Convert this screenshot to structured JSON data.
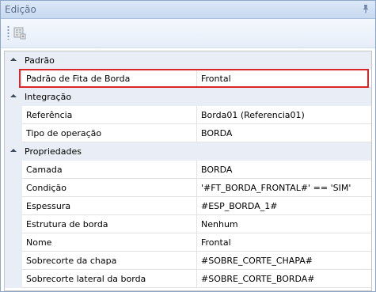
{
  "window": {
    "title": "Edição"
  },
  "categories": [
    {
      "label": "Padrão",
      "properties": [
        {
          "name": "Padrão de Fita de Borda",
          "value": "Frontal"
        }
      ]
    },
    {
      "label": "Integração",
      "properties": [
        {
          "name": "Referência",
          "value": "Borda01 (Referencia01)"
        },
        {
          "name": "Tipo de operação",
          "value": "BORDA"
        }
      ]
    },
    {
      "label": "Propriedades",
      "properties": [
        {
          "name": "Camada",
          "value": "BORDA"
        },
        {
          "name": "Condição",
          "value": "'#FT_BORDA_FRONTAL#' == 'SIM'"
        },
        {
          "name": "Espessura",
          "value": "#ESP_BORDA_1#"
        },
        {
          "name": "Estrutura de borda",
          "value": "Nenhum"
        },
        {
          "name": "Nome",
          "value": "Frontal"
        },
        {
          "name": "Sobrecorte da chapa",
          "value": "#SOBRE_CORTE_CHAPA#"
        },
        {
          "name": "Sobrecorte lateral da borda",
          "value": "#SOBRE_CORTE_BORDA#"
        }
      ]
    }
  ],
  "colors": {
    "highlight": "#d9262a",
    "category_bg": "#e9eef6",
    "title_text": "#5a6f8e"
  },
  "icons": {
    "pin": "pin-icon",
    "toolbar_button": "add-property-icon",
    "toggle": "collapse-triangle-icon"
  }
}
